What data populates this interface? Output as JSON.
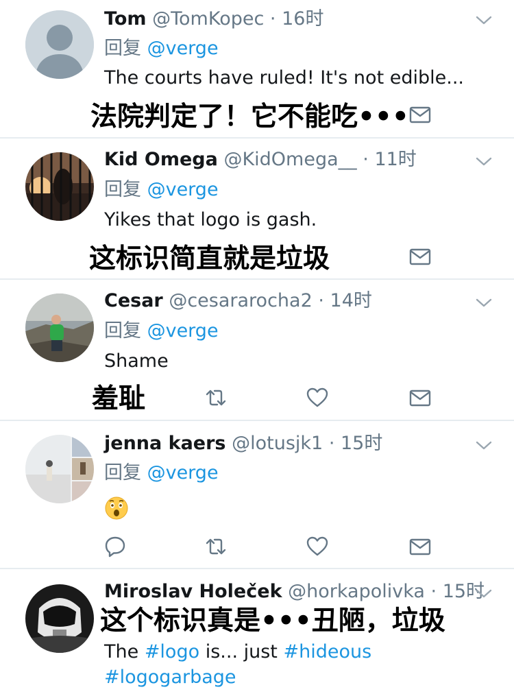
{
  "tweets": [
    {
      "name": "Tom",
      "handle": "@TomKopec",
      "dot": "·",
      "time": "16时",
      "reply_label": "回复",
      "reply_mention": "@verge",
      "text": "The courts have ruled! It's not edible...",
      "caption": "法院判定了！它不能吃•••"
    },
    {
      "name": "Kid Omega",
      "handle": "@KidOmega__",
      "dot": "·",
      "time": "11时",
      "reply_label": "回复",
      "reply_mention": "@verge",
      "text": "Yikes that logo is gash.",
      "caption": "这标识简直就是垃圾"
    },
    {
      "name": "Cesar",
      "handle": "@cesararocha2",
      "dot": "·",
      "time": "14时",
      "reply_label": "回复",
      "reply_mention": "@verge",
      "text": "Shame",
      "caption": "羞耻"
    },
    {
      "name": "jenna kaers",
      "handle": "@lotusjk1",
      "dot": "·",
      "time": "15时",
      "reply_label": "回复",
      "reply_mention": "@verge",
      "emoji": "astonished-face"
    },
    {
      "name": "Miroslav Holeček",
      "handle": "@horkapolivka",
      "dot": "·",
      "time": "15时",
      "caption": "这个标识真是•••丑陋，垃圾",
      "text_prefix": "The ",
      "hashtag1": "#logo",
      "text_middle": " is... just ",
      "hashtag2": "#hideous",
      "hashtag3": "#logogarbage"
    }
  ],
  "colors": {
    "link": "#1b95e0",
    "secondary": "#657786",
    "divider": "#e6ecf0"
  },
  "icons": {
    "reply": "reply-icon",
    "retweet": "retweet-icon",
    "like": "heart-icon",
    "dm": "envelope-icon",
    "more": "chevron-down-icon"
  }
}
